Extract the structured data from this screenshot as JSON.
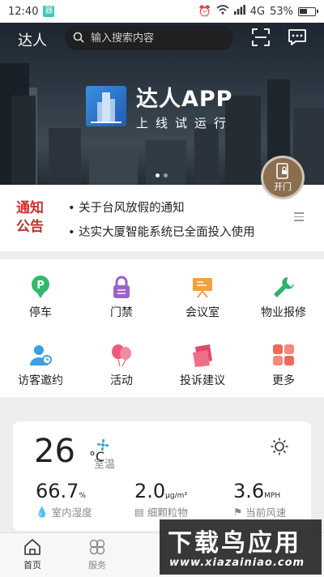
{
  "status_bar": {
    "time": "12:40",
    "network": "4G",
    "battery": "53%",
    "battery_level": 0.53
  },
  "header": {
    "city_label": "达人",
    "search_placeholder": "输入搜索内容"
  },
  "banner": {
    "title": "达人APP",
    "subtitle": "上线试运行"
  },
  "open_door": {
    "label": "开门"
  },
  "notice": {
    "tag_line1": "通知",
    "tag_line2": "公告",
    "items": [
      "• 关于台风放假的通知",
      "• 达实大厦智能系统已全面投入使用"
    ]
  },
  "services": [
    {
      "label": "停车",
      "icon": "parking-icon"
    },
    {
      "label": "门禁",
      "icon": "lock-icon"
    },
    {
      "label": "会议室",
      "icon": "meeting-board-icon"
    },
    {
      "label": "物业报修",
      "icon": "wrench-icon"
    },
    {
      "label": "访客邀约",
      "icon": "visitor-icon"
    },
    {
      "label": "活动",
      "icon": "balloon-icon"
    },
    {
      "label": "投诉建议",
      "icon": "complaint-icon"
    },
    {
      "label": "更多",
      "icon": "more-grid-icon"
    }
  ],
  "weather": {
    "temperature": "26",
    "temperature_unit": "°C",
    "temperature_label": "室温",
    "humidity": {
      "value": "66.7",
      "unit": "%",
      "label": "室内湿度"
    },
    "pm": {
      "value": "2.0",
      "unit": "μg/m³",
      "label": "细颗粒物"
    },
    "wind": {
      "value": "3.6",
      "unit": "MPH",
      "label": "当前风速"
    }
  },
  "tabbar": {
    "home": "首页",
    "service": "服务"
  },
  "watermark": {
    "line1": "下载鸟应用",
    "line2": "www.xiazainiao.com"
  },
  "colors": {
    "notice_red": "#d0302c",
    "open_button": "#8a6e4e",
    "parking_green": "#35b86b",
    "lock_purple": "#9b62c9",
    "meeting_orange": "#f2a23c",
    "wrench_green": "#2fb26a",
    "visitor_blue": "#3aa0e0",
    "balloon_pink": "#ef5a7a",
    "complaint_red": "#e04a6a",
    "more_coral": "#ef6a5a"
  }
}
